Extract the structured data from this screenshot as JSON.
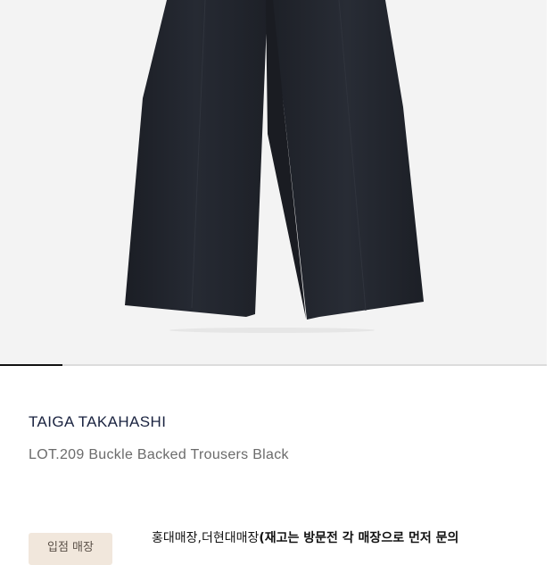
{
  "product": {
    "brand": "TAIGA TAKAHASHI",
    "name": "LOT.209 Buckle Backed Trousers Black",
    "image_label": "trousers",
    "gallery_progress": 0.115
  },
  "store": {
    "badge_label": "입점 매장",
    "locations_text": "홍대매장,더현대매장",
    "stock_note": "(재고는 방문전 각 매장으로 먼저 문의"
  },
  "colors": {
    "image_bg": "#f3f3f3",
    "trousers": "#23262e",
    "brand_text": "#1a2340",
    "badge_bg": "#f1e7dc"
  }
}
